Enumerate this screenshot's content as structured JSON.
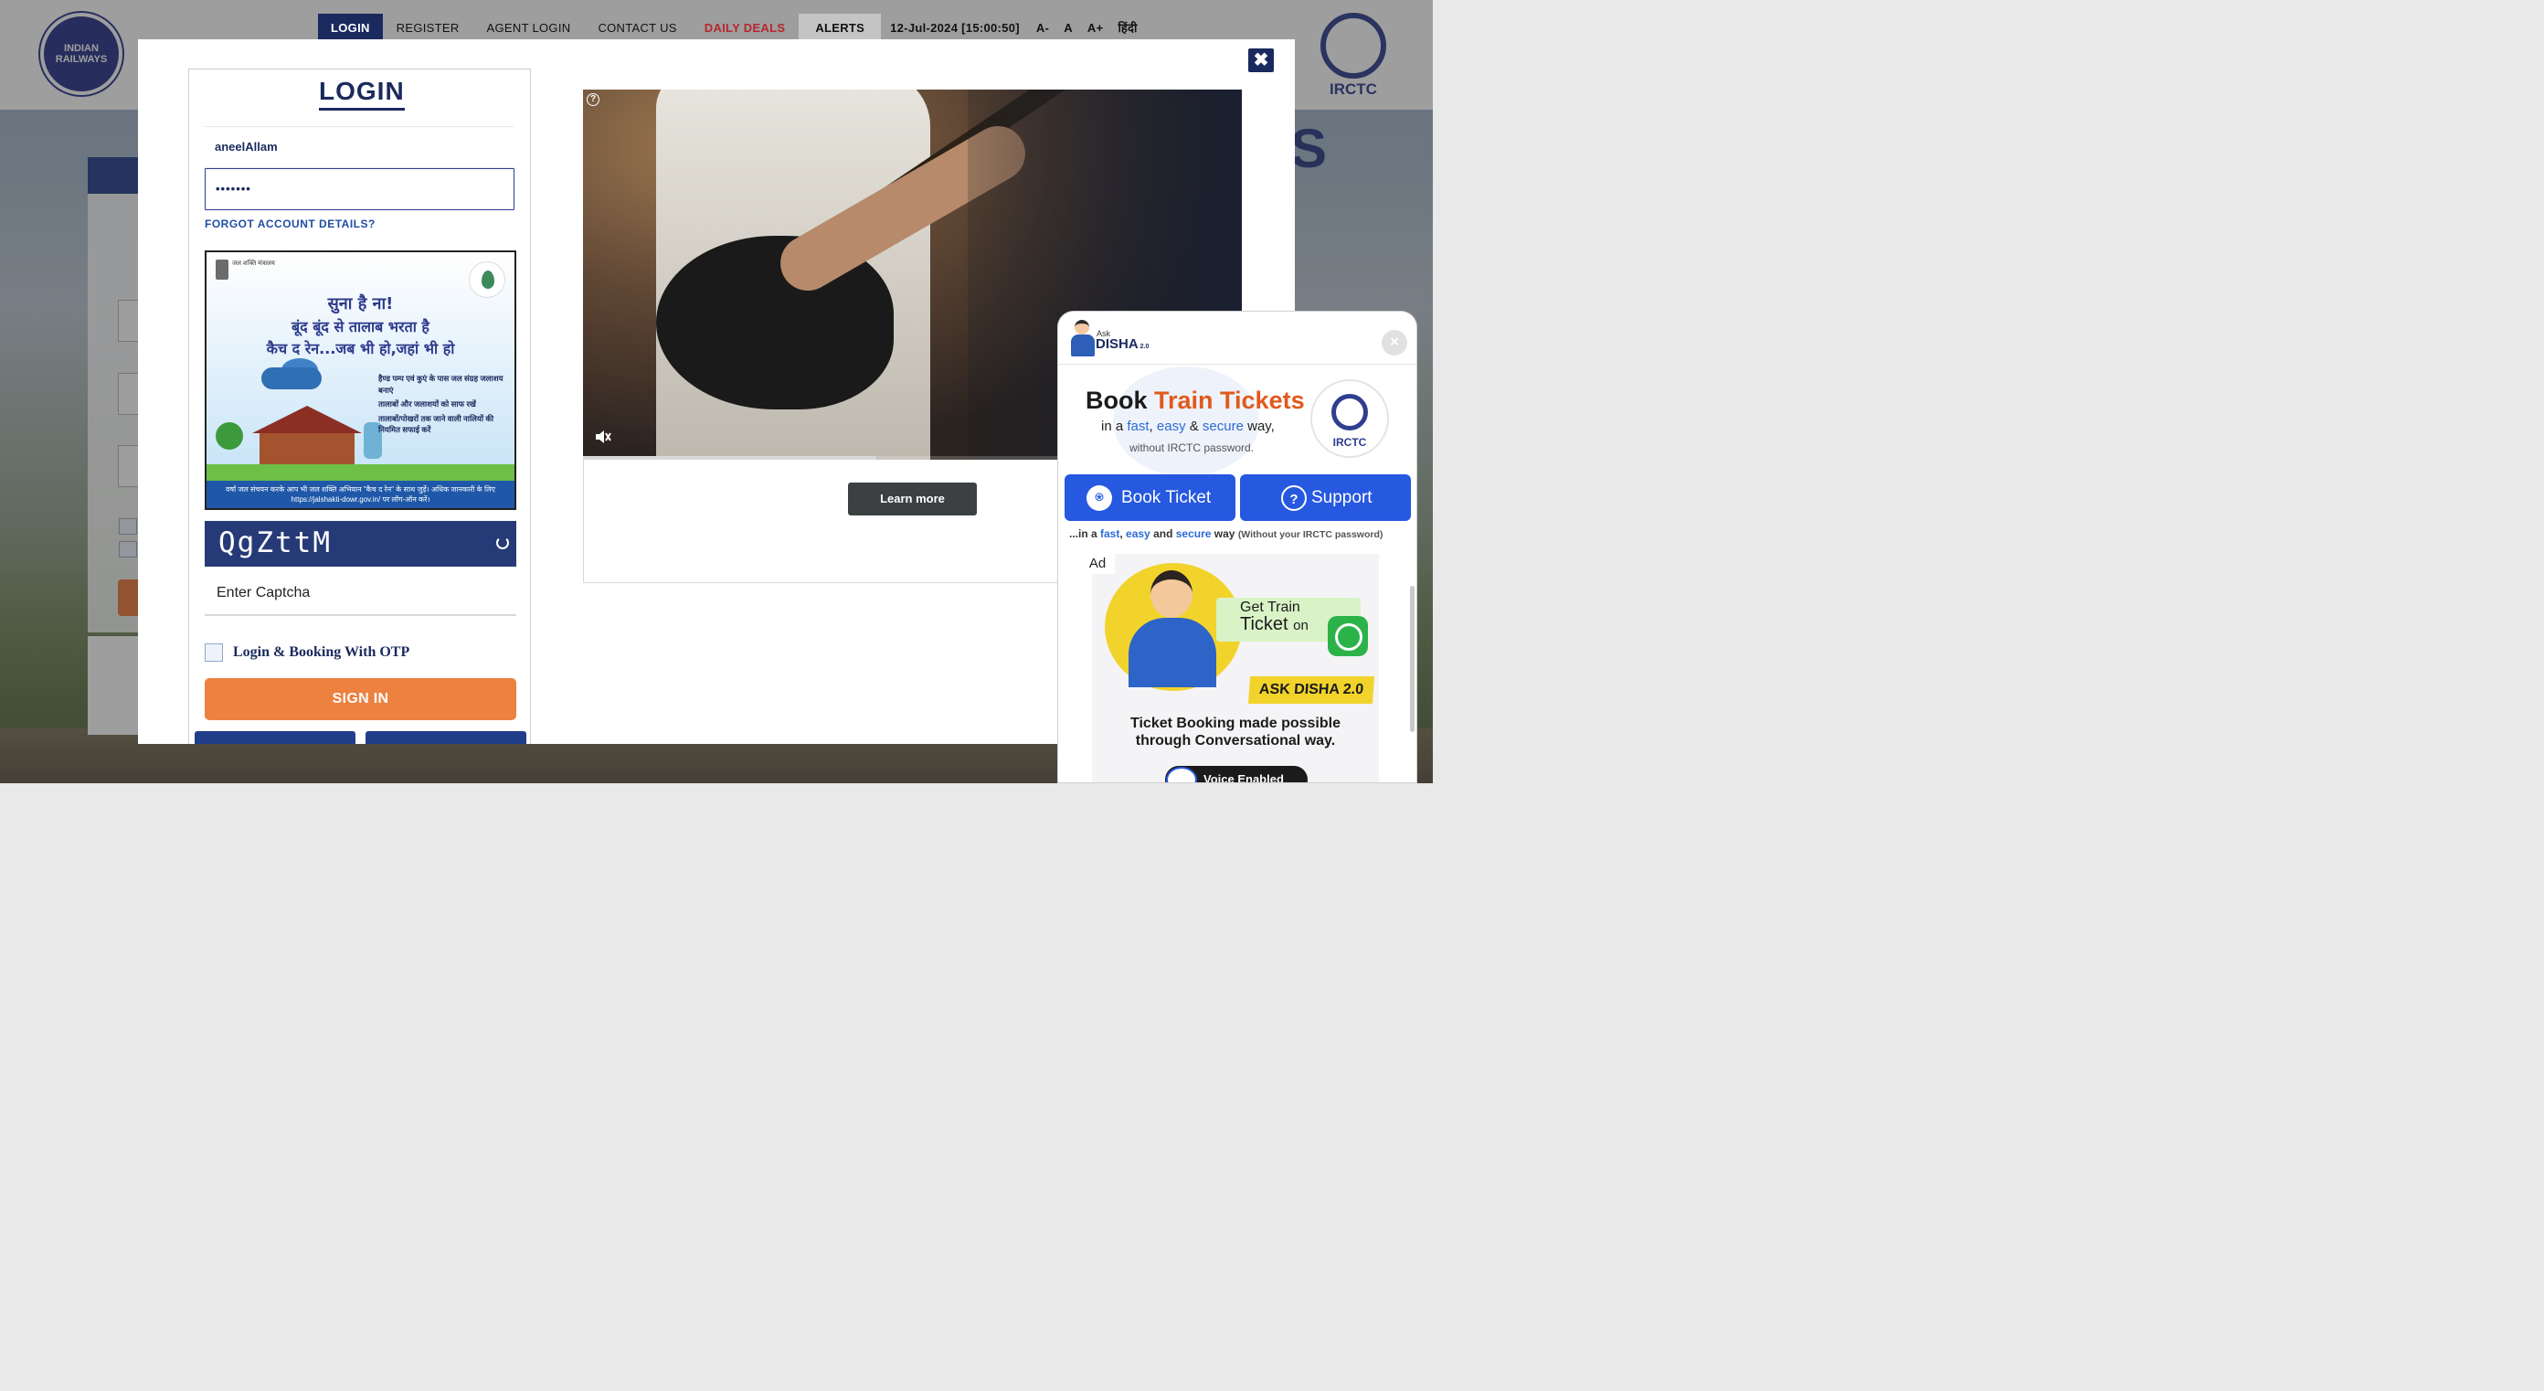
{
  "nav": {
    "items": [
      "LOGIN",
      "REGISTER",
      "AGENT LOGIN",
      "CONTACT US",
      "DAILY DEALS",
      "ALERTS"
    ],
    "datetime": "12-Jul-2024 [15:00:50]",
    "font_small": "A-",
    "font_normal": "A",
    "font_large": "A+",
    "language": "हिंदी"
  },
  "logos": {
    "railways": "INDIAN RAILWAYS",
    "irctc": "IRCTC"
  },
  "background": {
    "partial_heading": "S"
  },
  "login": {
    "title": "LOGIN",
    "username": "aneelAllam",
    "password_masked": "•••••••",
    "forgot_label": "FORGOT ACCOUNT DETAILS?",
    "captcha_text": "QgZttM",
    "captcha_placeholder": "Enter Captcha",
    "otp_label": "Login & Booking With OTP",
    "signin_label": "SIGN IN"
  },
  "banner_ad": {
    "emblem_text": "जल शक्ति मंत्रालय",
    "line1": "सुना है ना!",
    "line2": "बूंद बूंद से तालाब भरता है",
    "line3": "कैच द रेन...जब भी हो,जहां भी हो",
    "bullets": [
      "हैण्ड पम्प एवं कुएं के पास जल संग्रह जलाशय बनाएं",
      "तालाबों और जलाशयों को साफ रखें",
      "तालाबों/पोखरों तक जाने वाली नालियों की नियमित सफाई करें"
    ],
    "footer": "वर्षा जल संचयन करके आप भी जल शक्ति अभियान \"कैच द रेन\" के साथ जुड़ें। अधिक जानकारी के लिए https://jalshakti-dowr.gov.in/ पर लॉग-ऑन करें।"
  },
  "video_ad": {
    "info_icon": "?",
    "learn_more": "Learn more",
    "progress": 0.445
  },
  "disha": {
    "ask": "Ask",
    "name": "DISHA",
    "version": "2.0",
    "close_icon": "×",
    "headline_a": "Book ",
    "headline_b": "Train Tickets",
    "sub_a": "in a ",
    "sub_fast": "fast",
    "sub_comma": ", ",
    "sub_easy": "easy",
    "sub_amp": " & ",
    "sub_secure": "secure",
    "sub_end": " way,",
    "sub2": "without IRCTC password.",
    "irctc": "IRCTC",
    "book_ticket": "Book Ticket",
    "support": "Support",
    "tag_a": "...in a ",
    "tag_fast": "fast",
    "tag_comma": ", ",
    "tag_easy": "easy",
    "tag_and": " and ",
    "tag_secure": "secure",
    "tag_way": " way ",
    "tag_small": "(Without your IRCTC password)",
    "ad_label": "Ad",
    "ad_get": "Get Train",
    "ad_ticket": "Ticket",
    "ad_on": "on",
    "ad_askdisha": "ASK DISHA 2.0",
    "ad_tbm1": "Ticket Booking made possible",
    "ad_tbm2": "through Conversational way.",
    "ad_voice": "Voice Enabled"
  },
  "colors": {
    "navy": "#1b2a5e",
    "orange": "#ec8140",
    "disha_blue": "#2658e0",
    "deals_red": "#b7262e"
  }
}
